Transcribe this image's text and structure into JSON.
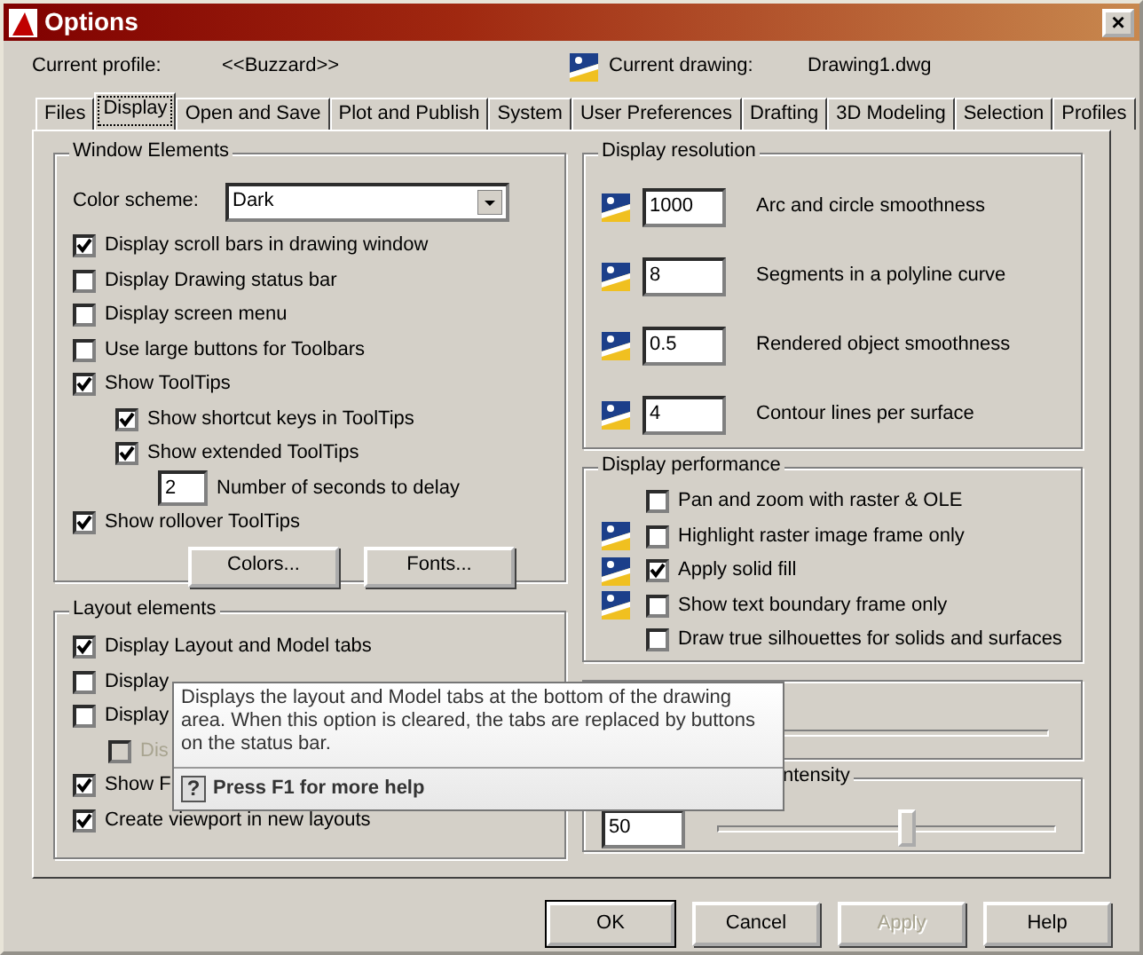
{
  "window": {
    "title": "Options",
    "close": "×"
  },
  "profile": {
    "label": "Current profile:",
    "value": "<<Buzzard>>"
  },
  "drawing": {
    "label": "Current drawing:",
    "value": "Drawing1.dwg"
  },
  "tabs": [
    {
      "label": "Files",
      "selected": false
    },
    {
      "label": "Display",
      "selected": true
    },
    {
      "label": "Open and Save",
      "selected": false
    },
    {
      "label": "Plot and Publish",
      "selected": false
    },
    {
      "label": "System",
      "selected": false
    },
    {
      "label": "User Preferences",
      "selected": false
    },
    {
      "label": "Drafting",
      "selected": false
    },
    {
      "label": "3D Modeling",
      "selected": false
    },
    {
      "label": "Selection",
      "selected": false
    },
    {
      "label": "Profiles",
      "selected": false
    }
  ],
  "window_elements": {
    "title": "Window Elements",
    "color_scheme": {
      "label": "Color scheme:",
      "value": "Dark"
    },
    "options": [
      {
        "kind": "checkbox",
        "label": "Display scroll bars in drawing window",
        "checked": true
      },
      {
        "kind": "checkbox",
        "label": "Display Drawing status bar",
        "checked": false
      },
      {
        "kind": "checkbox",
        "label": "Display screen menu",
        "checked": false
      },
      {
        "kind": "checkbox",
        "label": "Use large buttons for Toolbars",
        "checked": false
      },
      {
        "kind": "checkbox",
        "label": "Show ToolTips",
        "checked": true,
        "children": [
          {
            "kind": "checkbox",
            "label": "Show shortcut keys in ToolTips",
            "checked": true
          },
          {
            "kind": "checkbox",
            "label": "Show extended ToolTips",
            "checked": true,
            "children": [
              {
                "kind": "field",
                "value": "2",
                "label": "Number of seconds to delay"
              }
            ]
          }
        ]
      },
      {
        "kind": "checkbox",
        "label": "Show rollover ToolTips",
        "checked": true
      }
    ],
    "buttons": [
      "Colors...",
      "Fonts..."
    ]
  },
  "layout_elements": {
    "title": "Layout elements",
    "options": [
      {
        "label": "Display Layout and Model tabs",
        "checked": true,
        "disabled": false
      },
      {
        "label": "Display",
        "checked": false,
        "disabled": false
      },
      {
        "label": "Display",
        "checked": false,
        "disabled": false,
        "children": [
          {
            "label": "Dis",
            "checked": false,
            "disabled": true
          }
        ]
      },
      {
        "label": "Show F",
        "checked": true,
        "disabled": false
      },
      {
        "label": "Create viewport in new layouts",
        "checked": true,
        "disabled": false
      }
    ]
  },
  "display_resolution": {
    "title": "Display resolution",
    "items": [
      {
        "value": "1000",
        "label": "Arc and circle smoothness"
      },
      {
        "value": "8",
        "label": "Segments in a polyline curve"
      },
      {
        "value": "0.5",
        "label": "Rendered object smoothness"
      },
      {
        "value": "4",
        "label": "Contour lines per surface"
      }
    ]
  },
  "display_performance": {
    "title": "Display performance",
    "options": [
      {
        "kind": "plain",
        "label": "Pan and zoom with raster & OLE",
        "checked": false
      },
      {
        "kind": "saved",
        "label": "Highlight raster image frame only",
        "checked": false
      },
      {
        "kind": "saved",
        "label": "Apply solid fill",
        "checked": true
      },
      {
        "kind": "saved",
        "label": "Show text boundary frame only",
        "checked": false
      },
      {
        "kind": "plain",
        "label": "Draw true silhouettes for solids and surfaces",
        "checked": false
      }
    ]
  },
  "fade": {
    "title": "ntensity",
    "value": "50",
    "level": 0.56
  },
  "tooltip": {
    "text": "Displays the layout and Model tabs at the bottom of the drawing area. When this option is cleared, the tabs are replaced by buttons on the status bar.",
    "help_icon": "?",
    "help": "Press F1 for more help"
  },
  "buttons": [
    {
      "label": "OK",
      "default": true,
      "disabled": false
    },
    {
      "label": "Cancel",
      "default": false,
      "disabled": false
    },
    {
      "label": "Apply",
      "default": false,
      "disabled": true
    },
    {
      "label": "Help",
      "default": false,
      "disabled": false
    }
  ]
}
